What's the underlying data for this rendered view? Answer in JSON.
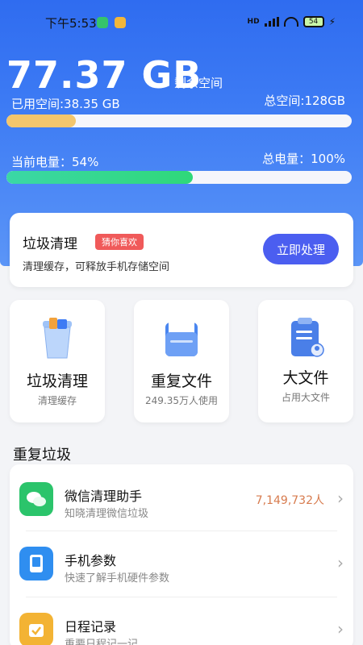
{
  "status_bar": {
    "time": "下午5:53",
    "battery": "54"
  },
  "storage": {
    "free": "77.37 GB",
    "free_label": "剩余空间",
    "used": "已用空间:38.35 GB",
    "total": "总空间:128GB",
    "used_fraction": 0.2
  },
  "power": {
    "current": "当前电量：54%",
    "total": "总电量：100%",
    "level": 0.54
  },
  "cleanup_card": {
    "title": "垃圾清理",
    "tag": "猜你喜欢",
    "subtitle": "清理缓存，可释放手机存储空间",
    "button": "立即处理"
  },
  "tiles": [
    {
      "title": "垃圾清理",
      "subtitle": "清理缓存",
      "icon": "trash-can-icon"
    },
    {
      "title": "重复文件",
      "subtitle": "249.35万人使用",
      "icon": "folder-icon"
    },
    {
      "title": "大文件",
      "subtitle": "占用大文件",
      "icon": "clipboard-icon"
    }
  ],
  "section": {
    "title": "重复垃圾"
  },
  "list": [
    {
      "name": "微信清理助手",
      "desc": "知晓清理微信垃圾",
      "count": "7,149,732人",
      "icon": "wechat-icon",
      "color": "#2bc46b"
    },
    {
      "name": "手机参数",
      "desc": "快速了解手机硬件参数",
      "count": "",
      "icon": "phone-icon",
      "color": "#2f8ef0"
    },
    {
      "name": "日程记录",
      "desc": "重要日程记一记",
      "count": "",
      "icon": "calendar-icon",
      "color": "#f3b334"
    }
  ],
  "colors": {
    "primary": "#3d7bf4",
    "button": "#4b5ef0",
    "storage_bar": "#f3c66d",
    "power_bar": "#2fd879",
    "tag": "#f05a5a"
  }
}
